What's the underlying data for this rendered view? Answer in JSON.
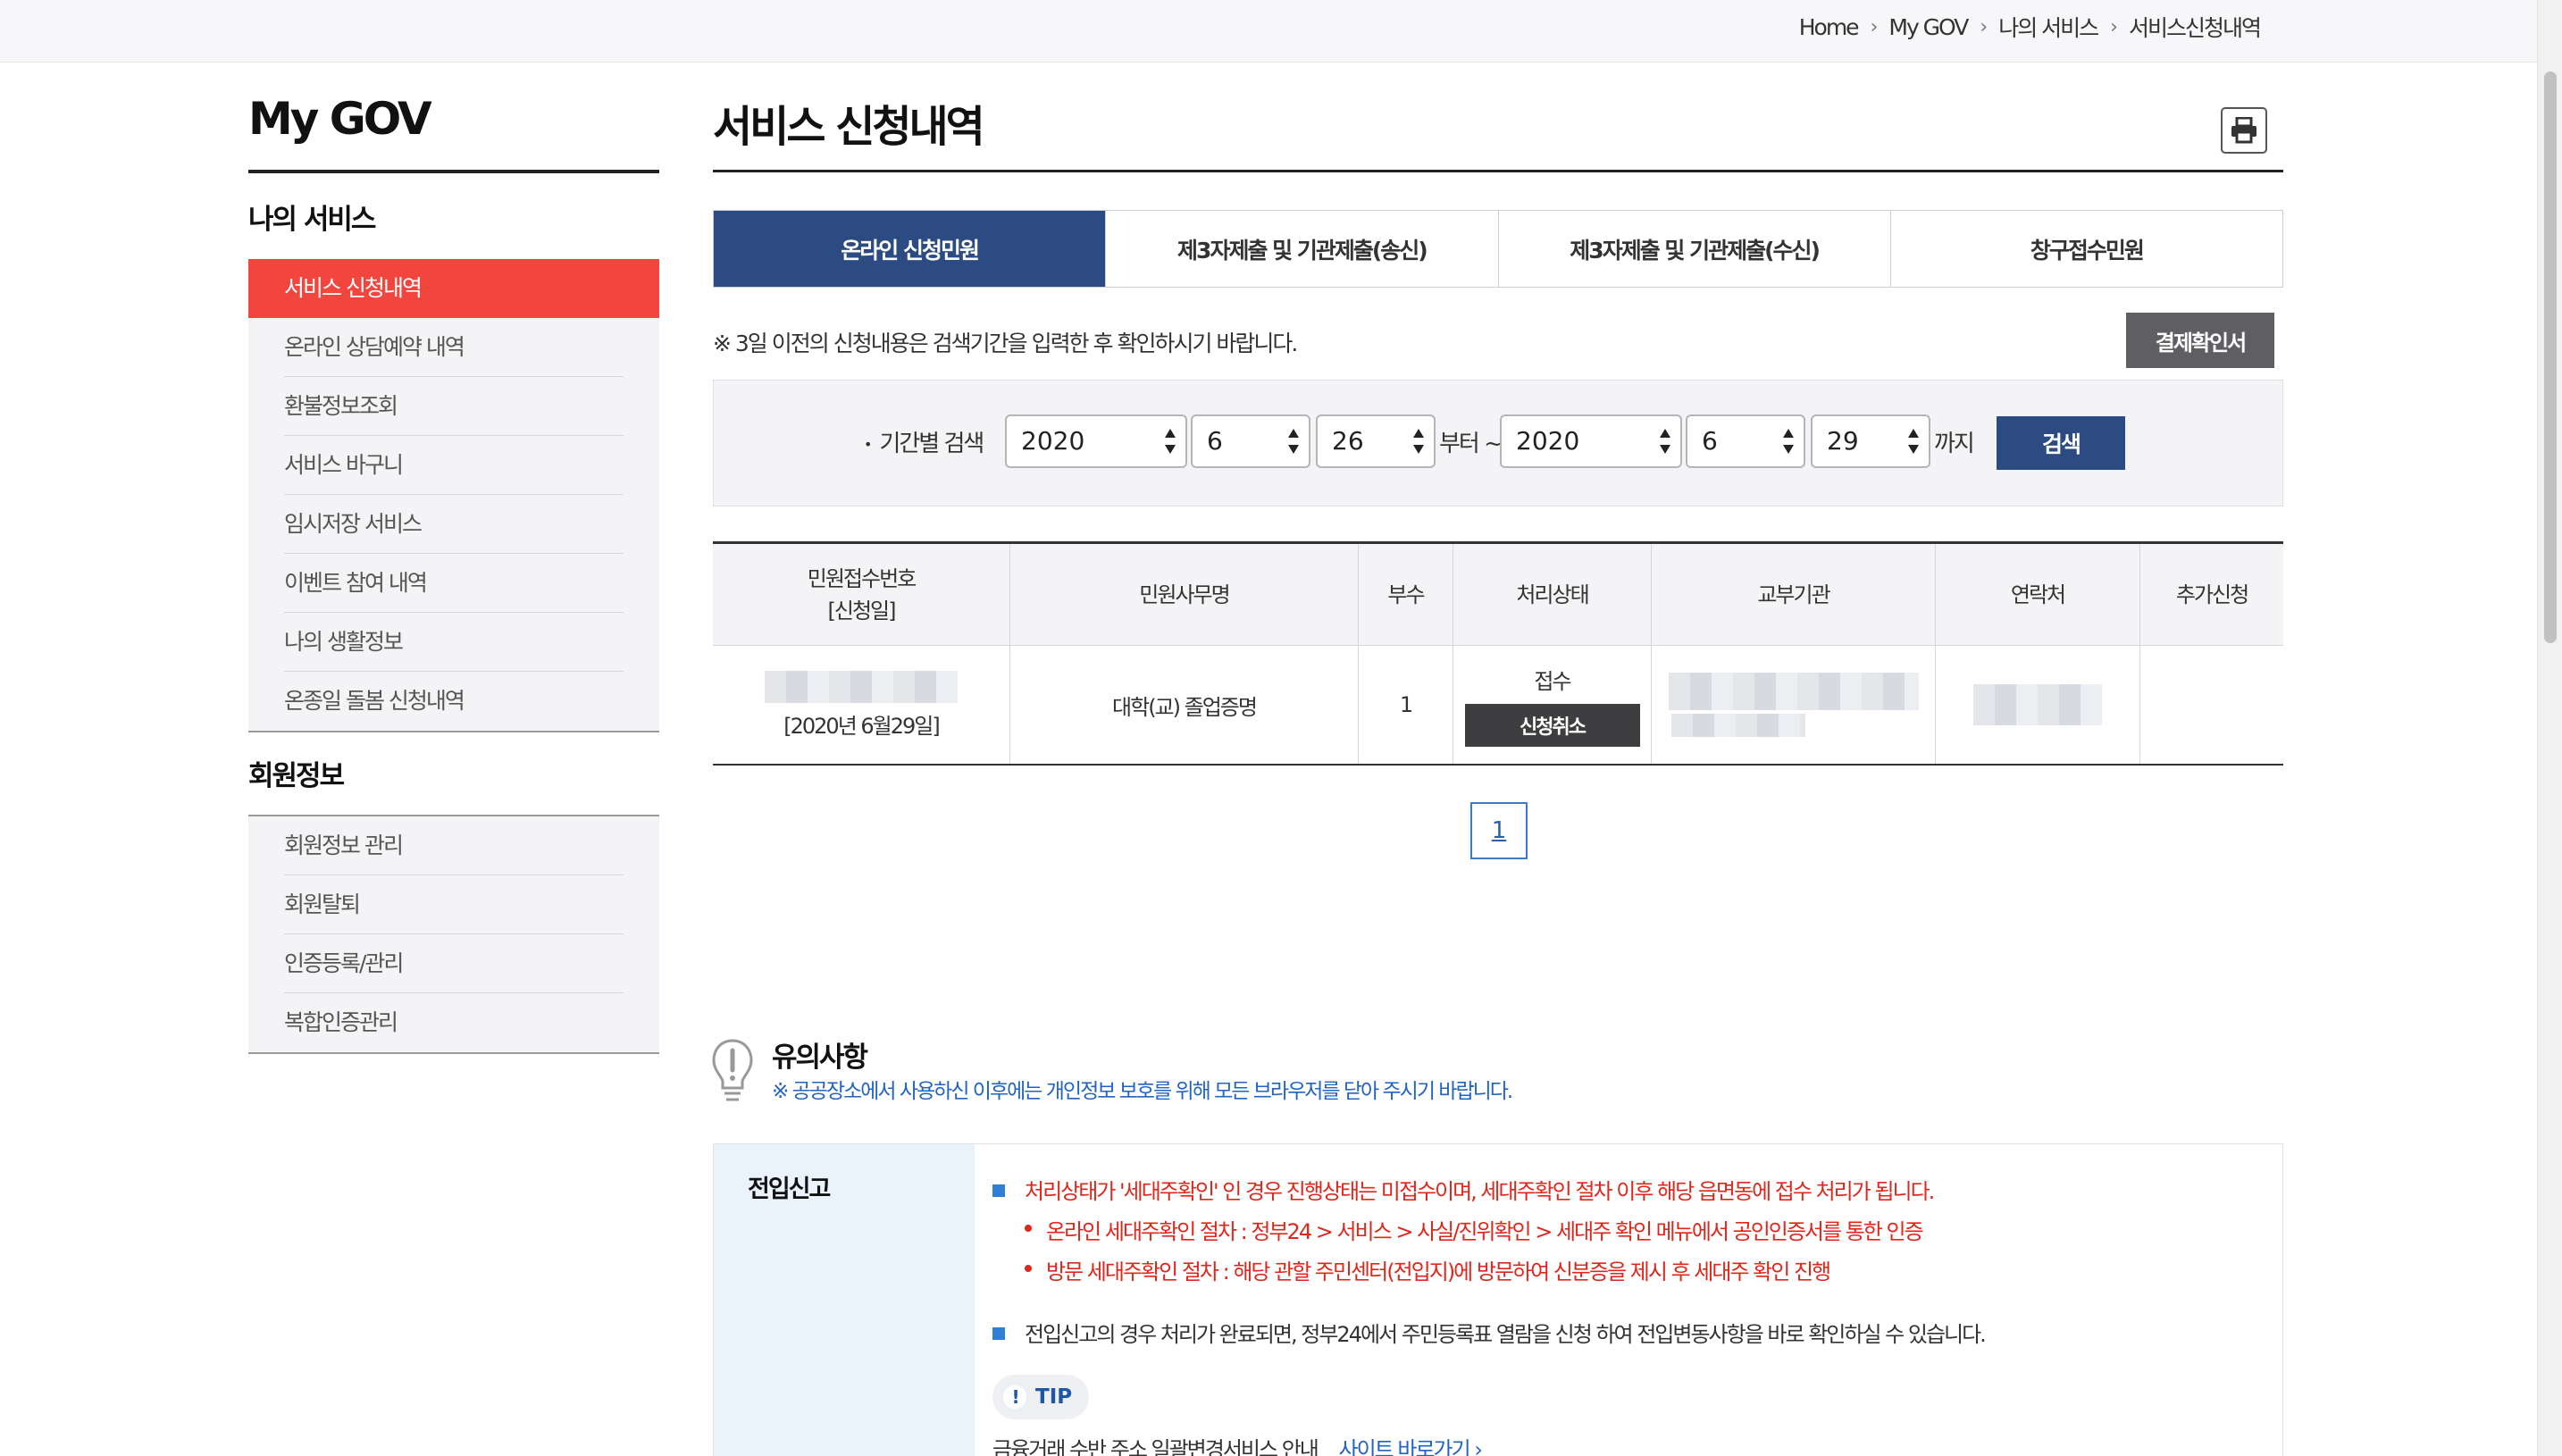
{
  "breadcrumb": [
    "Home",
    "My GOV",
    "나의 서비스",
    "서비스신청내역"
  ],
  "sidebar": {
    "title": "My GOV",
    "group1": "나의 서비스",
    "items1": [
      "서비스 신청내역",
      "온라인 상담예약 내역",
      "환불정보조회",
      "서비스 바구니",
      "임시저장 서비스",
      "이벤트 참여 내역",
      "나의 생활정보",
      "온종일 돌봄 신청내역"
    ],
    "group2": "회원정보",
    "items2": [
      "회원정보 관리",
      "회원탈퇴",
      "인증등록/관리",
      "복합인증관리"
    ]
  },
  "main": {
    "title": "서비스 신청내역",
    "tabs": [
      "온라인 신청민원",
      "제3자제출 및 기관제출(송신)",
      "제3자제출 및 기관제출(수신)",
      "창구접수민원"
    ],
    "notice": "※ 3일 이전의 신청내용은 검색기간을 입력한 후 확인하시기 바랍니다.",
    "receipt_button": "결제확인서"
  },
  "search": {
    "label": "기간별 검색",
    "from": {
      "year": "2020",
      "month": "6",
      "day": "26"
    },
    "from_text": "부터 ~",
    "to": {
      "year": "2020",
      "month": "6",
      "day": "29"
    },
    "to_text": "까지",
    "button": "검색"
  },
  "table": {
    "headers": [
      "민원접수번호",
      "[신청일]",
      "민원사무명",
      "부수",
      "처리상태",
      "교부기관",
      "연락처",
      "추가신청"
    ],
    "rows": [
      {
        "date": "[2020년 6월29일]",
        "name": "대학(교) 졸업증명",
        "copies": "1",
        "status": "접수",
        "cancel": "신청취소"
      }
    ]
  },
  "pagination": {
    "current": "1"
  },
  "caution": {
    "title": "유의사항",
    "subtitle": "※  공공장소에서 사용하신 이후에는 개인정보 보호를 위해 모든 브라우저를 닫아 주시기 바랍니다."
  },
  "info": {
    "heading": "전입신고",
    "line1": "처리상태가 '세대주확인' 인 경우 진행상태는 미접수이며, 세대주확인 절차 이후 해당 읍면동에 접수 처리가 됩니다.",
    "line2": "온라인 세대주확인 절차 : 정부24 > 서비스 > 사실/진위확인 > 세대주 확인 메뉴에서 공인인증서를 통한 인증",
    "line3": "방문 세대주확인 절차 : 해당 관할 주민센터(전입지)에 방문하여 신분증을 제시 후 세대주 확인 진행",
    "line4": "전입신고의 경우 처리가 완료되면, 정부24에서 주민등록표 열람을 신청 하여 전입변동사항을 바로 확인하실 수 있습니다.",
    "tip_label": "TIP",
    "tip_text": "금융거래 수반 주소 일괄변경서비스 안내",
    "tip_link": "사이트 바로가기"
  },
  "colors": {
    "accent_red": "#f1453d",
    "navy": "#2b4b82",
    "link_blue": "#2264c2"
  }
}
